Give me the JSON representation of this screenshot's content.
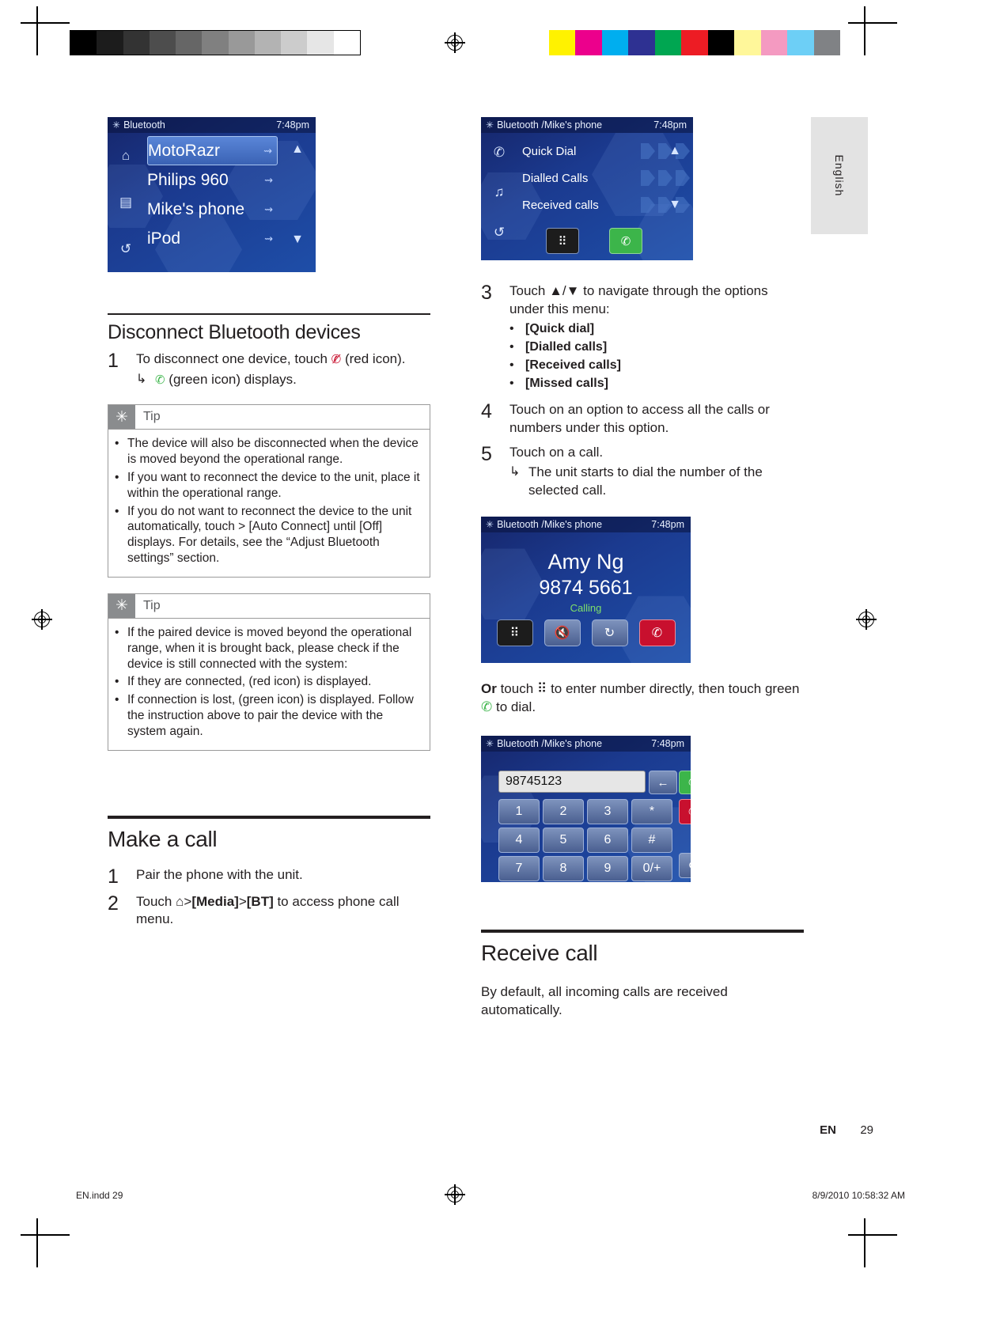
{
  "page": {
    "language_tab": "English",
    "footer_lang": "EN",
    "footer_page": "29",
    "bottom_left": "EN.indd   29",
    "bottom_right": "8/9/2010   10:58:32 AM"
  },
  "colors": {
    "screen_blue_dark": "#16266b",
    "screen_blue_light": "#1e4ea8",
    "green": "#3cb54a",
    "red": "#c8102e",
    "tip_icon_bg": "#8a8c8e",
    "lang_tab_bg": "#e3e3e3"
  },
  "colorbar": [
    "#fff200",
    "#ec008c",
    "#00aeef",
    "#2e3192",
    "#00a651",
    "#ed1c24",
    "#000000",
    "#fff79a",
    "#f49ac1",
    "#6dcff6",
    "#808285"
  ],
  "screens": {
    "device_list": {
      "status_title": "Bluetooth",
      "clock": "7:48pm",
      "items": [
        {
          "name": "MotoRazr",
          "selected": true
        },
        {
          "name": "Philips 960",
          "selected": false
        },
        {
          "name": "Mike's phone",
          "selected": false
        },
        {
          "name": "iPod",
          "selected": false
        }
      ],
      "rail_icons": [
        "home-icon",
        "list-icon",
        "back-icon"
      ],
      "scroll_up": "▲",
      "scroll_down": "▼"
    },
    "phone_menu": {
      "status_title": "Bluetooth /Mike's phone",
      "clock": "7:48pm",
      "items": [
        "Quick Dial",
        "Dialled Calls",
        "Received calls"
      ],
      "rail_icons": [
        "phone-icon",
        "music-icon",
        "back-icon"
      ],
      "scroll_up": "▲",
      "scroll_down": "▼",
      "buttons": [
        "keypad-icon",
        "answer-call-icon"
      ]
    },
    "calling": {
      "status_title": "Bluetooth /Mike's phone",
      "clock": "7:48pm",
      "caller_name": "Amy Ng",
      "caller_number": "9874 5661",
      "state": "Calling",
      "buttons": [
        "keypad-icon",
        "mute-icon",
        "transfer-icon",
        "end-call-icon"
      ]
    },
    "dialpad": {
      "status_title": "Bluetooth /Mike's phone",
      "clock": "7:48pm",
      "entered_number": "98745123",
      "keys": [
        "1",
        "2",
        "3",
        "*",
        "4",
        "5",
        "6",
        "#",
        "7",
        "8",
        "9",
        "0/+"
      ],
      "side_buttons": [
        "backspace-icon",
        "call-icon",
        "end-call-icon",
        "back-icon"
      ]
    }
  },
  "left_column": {
    "section_title": "Disconnect Bluetooth devices",
    "steps": [
      {
        "num": "1",
        "text_before": "To disconnect one device, touch ",
        "text_after": " (red icon).",
        "sub": {
          "arrow": "↳",
          "text_after": " (green icon) displays."
        }
      }
    ],
    "tip1": {
      "label": "Tip",
      "items": [
        "The device will also be disconnected when the device is moved beyond the operational range.",
        "If you want to reconnect the device to the unit, place it within the operational range.",
        "If you do not want to reconnect the device to the unit automatically, touch  >  [Auto Connect] until [Off] displays. For details, see the “Adjust Bluetooth settings” section."
      ]
    },
    "tip2": {
      "label": "Tip",
      "items": [
        "If the paired device is moved beyond the operational range, when it is brought back, please check if the device is still connected with the system:",
        "If they are connected,  (red icon) is displayed.",
        "If connection is lost,  (green icon) is displayed. Follow the instruction above to pair the device with the system again."
      ]
    },
    "make_call": {
      "title": "Make a call",
      "steps": [
        {
          "num": "1",
          "text": "Pair the phone with the unit."
        },
        {
          "num": "2",
          "text_parts": [
            "Touch ",
            ">",
            "[Media]",
            ">",
            "[BT]",
            " to access phone call menu."
          ]
        }
      ]
    }
  },
  "right_column": {
    "steps": [
      {
        "num": "3",
        "text": "Touch ▲/▼ to navigate through the options under this menu:",
        "options": [
          "[Quick dial]",
          "[Dialled calls]",
          "[Received calls]",
          "[Missed calls]"
        ]
      },
      {
        "num": "4",
        "text": "Touch on an option to access all the calls or numbers under this option."
      },
      {
        "num": "5",
        "text": "Touch on a call.",
        "sub": {
          "arrow": "↳",
          "text": "The unit starts to dial the number of the selected call."
        }
      }
    ],
    "or_note": {
      "lead": "Or",
      "mid": " touch ",
      "mid2": " to enter number directly, then touch green ",
      "tail": " to dial."
    },
    "receive_call": {
      "title": "Receive call",
      "body": "By default, all incoming calls are received automatically."
    }
  }
}
